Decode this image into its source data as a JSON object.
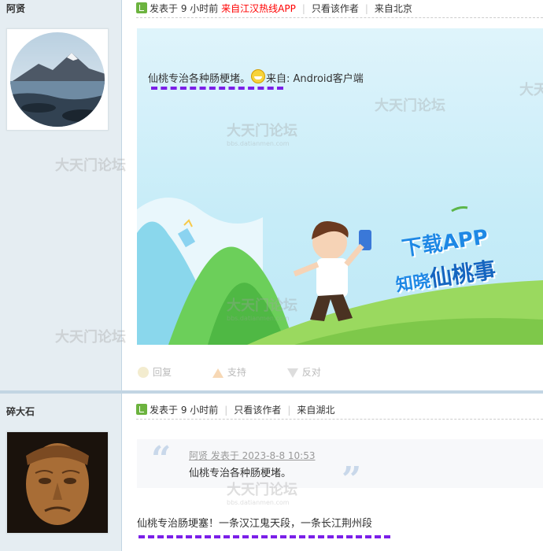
{
  "posts": [
    {
      "username": "阿贤",
      "meta": {
        "posted_label": "发表于",
        "time": "9 小时前",
        "source": "来自江汉热线APP",
        "only_author": "只看该作者",
        "location": "来自北京"
      },
      "message_text": "仙桃专治各种肠梗堵。",
      "client_text": "来自: Android客户端",
      "banner": {
        "line1": "下载APP",
        "line2_a": "知晓",
        "line2_b": "仙桃事"
      },
      "actions": {
        "reply": "回复",
        "support": "支持",
        "oppose": "反对"
      }
    },
    {
      "username": "碎大石",
      "meta": {
        "posted_label": "发表于",
        "time": "9 小时前",
        "only_author": "只看该作者",
        "location": "来自湖北"
      },
      "quote": {
        "header": "阿贤 发表于 2023-8-8 10:53",
        "body": "仙桃专治各种肠梗堵。"
      },
      "reply_text": "仙桃专治肠埂塞！一条汉江鬼天段，一条长江荆州段"
    }
  ],
  "watermark": {
    "title": "大天门论坛",
    "url": "bbs.datianmen.com"
  },
  "colors": {
    "sidebar": "#e5edf2",
    "accent_red": "#ff0000",
    "annotation": "#7b1fe8",
    "banner_blue": "#1e88e5"
  }
}
